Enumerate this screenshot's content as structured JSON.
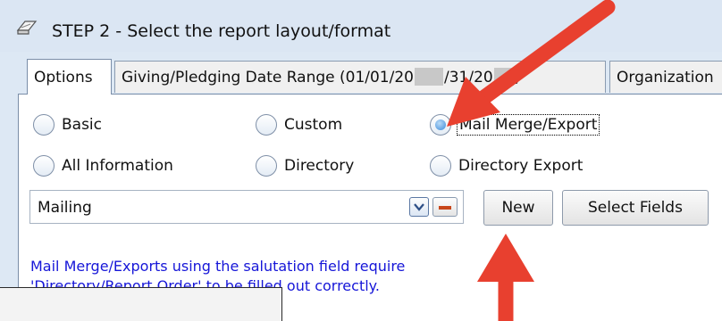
{
  "window": {
    "title": "STEP 2 - Select the report layout/format"
  },
  "tabs": {
    "options": "Options",
    "date_range_prefix": "Giving/Pledging Date Range (01/01/20",
    "date_range_mid": "/31/20",
    "date_range_suffix": ")",
    "organization": "Organization"
  },
  "layout_options": {
    "basic": "Basic",
    "custom": "Custom",
    "mail_merge": "Mail Merge/Export",
    "all_info": "All Information",
    "directory": "Directory",
    "directory_export": "Directory Export",
    "selected": "Mail Merge/Export"
  },
  "layout_select": {
    "value": "Mailing"
  },
  "buttons": {
    "new": "New",
    "select_fields": "Select Fields"
  },
  "note": {
    "line1": "Mail Merge/Exports using the salutation field require",
    "line2": "'Directory/Report Order' to be filled out correctly."
  },
  "colors": {
    "annotation_arrow": "#e8402f",
    "note_text": "#1616d8",
    "window_bg": "#dde8f4"
  }
}
